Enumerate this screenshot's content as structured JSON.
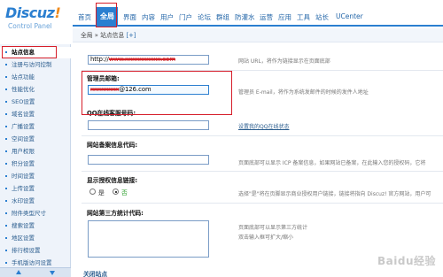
{
  "logo": {
    "brand": "Discuz",
    "bang": "!",
    "sub": "Control Panel"
  },
  "topnav": [
    {
      "label": "首页",
      "active": false
    },
    {
      "label": "全局",
      "active": true
    },
    {
      "label": "界面",
      "active": false
    },
    {
      "label": "内容",
      "active": false
    },
    {
      "label": "用户",
      "active": false
    },
    {
      "label": "门户",
      "active": false
    },
    {
      "label": "论坛",
      "active": false
    },
    {
      "label": "群组",
      "active": false
    },
    {
      "label": "防灌水",
      "active": false
    },
    {
      "label": "运营",
      "active": false
    },
    {
      "label": "应用",
      "active": false
    },
    {
      "label": "工具",
      "active": false
    },
    {
      "label": "站长",
      "active": false
    },
    {
      "label": "UCenter",
      "active": false
    }
  ],
  "breadcrumb": {
    "path": "全局 » 站点信息",
    "plus": "[+]"
  },
  "sidebar": [
    "站点信息",
    "注册与访问控制",
    "站点功能",
    "性能优化",
    "SEO设置",
    "域名设置",
    "广播设置",
    "空间设置",
    "用户权限",
    "积分设置",
    "时间设置",
    "上传设置",
    "水印设置",
    "附件类型尺寸",
    "搜索设置",
    "地区设置",
    "排行榜设置",
    "手机版访问设置"
  ],
  "form": {
    "site_url": {
      "value_prefix": "http://",
      "value_redacted": "www.xxxxxxxxxx.com",
      "hint": "网站 URL，将作为链接显示在页面底部"
    },
    "admin_email": {
      "label": "管理员邮箱:",
      "value_redacted": "xxxxxxxx",
      "value_suffix": "@126.com",
      "hint": "管理员 E-mail，将作为系统发邮件的时候的发件人地址"
    },
    "qq": {
      "label": "QQ在线客服号码:",
      "value": "",
      "hint": "设置我的QQ在线状态"
    },
    "icp": {
      "label": "网站备案信息代码:",
      "value": "",
      "hint": "页面底部可以显示 ICP 备案信息，如果网站已备案，在此输入您的授权码，它将"
    },
    "license": {
      "label": "显示授权信息链接:",
      "options": [
        "是",
        "否"
      ],
      "selected": "否",
      "hint": "选择\"是\"将在页脚显示商业授权用户链接，链接将指向 Discuz! 官方网站，用户可"
    },
    "stats": {
      "label": "网站第三方统计代码:",
      "hint_line1": "页面底部可以显示第三方统计",
      "hint_line2": "双击输入框可扩大/缩小"
    },
    "next_section": "关闭站点"
  },
  "watermark": "Baidu经验"
}
